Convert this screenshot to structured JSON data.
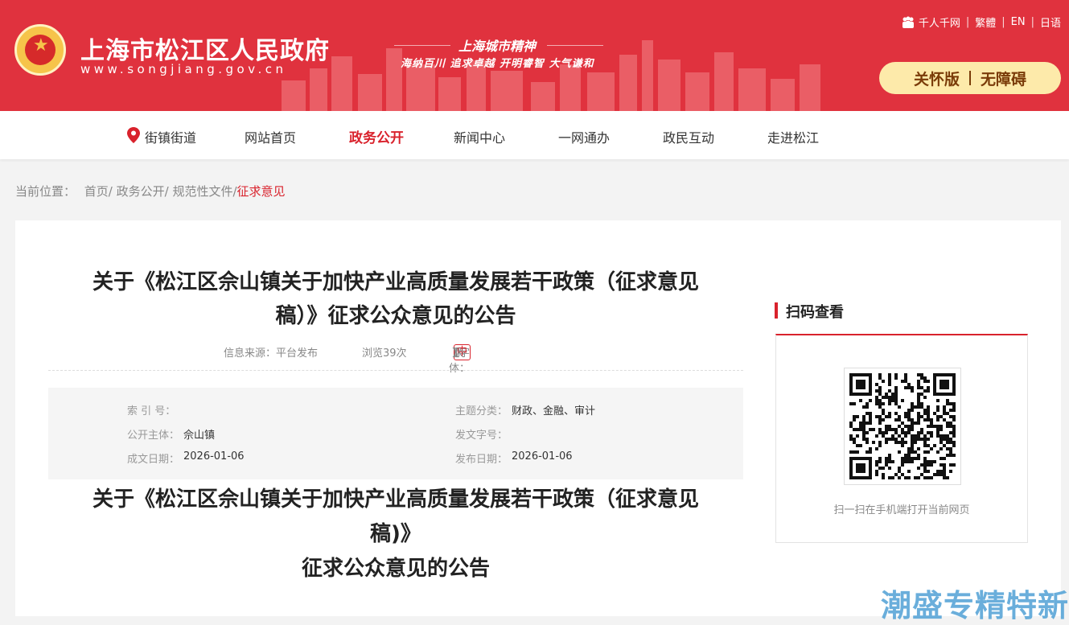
{
  "header": {
    "title": "上海市松江区人民政府",
    "url": "www.songjiang.gov.cn",
    "spirit_title": "上海城市精神",
    "spirit_motto": "海纳百川  追求卓越  开明睿智  大气谦和",
    "links": [
      "千人千网",
      "繁體",
      "EN",
      "日语"
    ],
    "care_mode": "关怀版",
    "accessible": "无障碍"
  },
  "nav": {
    "items": [
      "街镇街道",
      "网站首页",
      "政务公开",
      "新闻中心",
      "一网通办",
      "政民互动",
      "走进松江"
    ],
    "active": "政务公开"
  },
  "breadcrumb": {
    "label": "当前位置：",
    "items": [
      "首页/",
      "政务公开/",
      "规范性文件/"
    ],
    "current": "征求意见"
  },
  "article": {
    "title_line1": "关于《松江区佘山镇关于加快产业高质量发展若干政策（征求意见",
    "title_line2": "稿）》征求公众意见的公告",
    "source": "信息来源：平台发布",
    "views": "浏览39次",
    "font_label": "【字体：",
    "font_big": "大",
    "font_mid": "中",
    "font_small": "小",
    "font_close": "】",
    "info": {
      "index_label": "索 引 号：",
      "index_value": "",
      "subject_label": "公开主体：",
      "subject_value": "佘山镇",
      "created_label": "成文日期：",
      "created_value": "2026-01-06",
      "category_label": "主题分类：",
      "category_value": "财政、金融、审计",
      "docno_label": "发文字号：",
      "docno_value": "",
      "published_label": "发布日期：",
      "published_value": "2026-01-06"
    },
    "body_title_line1": "关于《松江区佘山镇关于加快产业高质量发展若干政策（征求意见",
    "body_title_line2": "稿)》",
    "body_title_line3": "征求公众意见的公告"
  },
  "sidebar": {
    "qr_title": "扫码查看",
    "qr_caption": "扫一扫在手机端打开当前网页"
  },
  "watermark": "潮盛专精特新",
  "colors": {
    "brand_red": "#e0323e",
    "accent_red": "#d9222c",
    "care_bg": "#fdeaaa"
  }
}
